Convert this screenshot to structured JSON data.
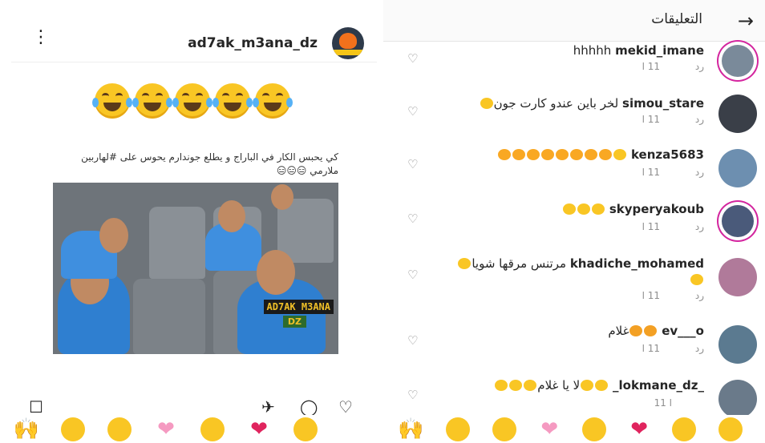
{
  "left_panel": {
    "username": "ad7ak_m3ana_dz",
    "kebab_icon": "⋮",
    "caption_emoji_count": 5,
    "meme_text": "كي يحبس الكار في الباراج و يطلع جوندارم يحوس على #لهاربين ملارمي 😑😑😑",
    "watermark": "AD7AK M3ANA",
    "watermark_sub": "DZ"
  },
  "right_panel": {
    "title": "التعليقات",
    "back_icon": "arrow-right-icon",
    "comments": [
      {
        "user": "mekid_imane",
        "text": "hhhhh ",
        "time": "11 ا",
        "reply": "رد",
        "avatar_color": "#7a8a9a",
        "ring": true
      },
      {
        "user": "simou_stare",
        "text": "لخر باين عندو كارت جون",
        "time": "11 ا",
        "reply": "رد",
        "avatar_color": "#3a3f48",
        "ring": false
      },
      {
        "user": "kenza5683",
        "text": "",
        "time": "11 ا",
        "reply": "رد",
        "avatar_color": "#6d8fb0",
        "ring": false
      },
      {
        "user": "skyperyakoub",
        "text": "",
        "time": "11 ا",
        "reply": "رد",
        "avatar_color": "#4a5a7a",
        "ring": true
      },
      {
        "user": "khadiche_mohamed",
        "text": "مرتنس مرقها شويا",
        "time": "11 ا",
        "reply": "رد",
        "avatar_color": "#b07a9a",
        "ring": false
      },
      {
        "user": "ev___o",
        "text": "غلام",
        "time": "11 ا",
        "reply": "رد",
        "avatar_color": "#5b7a90",
        "ring": false
      },
      {
        "user": "_lokmane_dz_",
        "text": "لا يا غلام",
        "time": "11 ا",
        "reply": "",
        "avatar_color": "#6a7a8a",
        "ring": false
      }
    ]
  },
  "emoji_bar": {
    "items": [
      "raised-hands-icon",
      "slight-smile-icon",
      "unamused-icon",
      "sparkling-heart-icon",
      "kiss-icon",
      "red-heart-icon",
      "heart-eyes-icon",
      "grin-icon"
    ]
  },
  "colors": {
    "accent_ring": "#d6249f",
    "emoji_yellow": "#f9c624",
    "heart_red": "#e0245e"
  }
}
